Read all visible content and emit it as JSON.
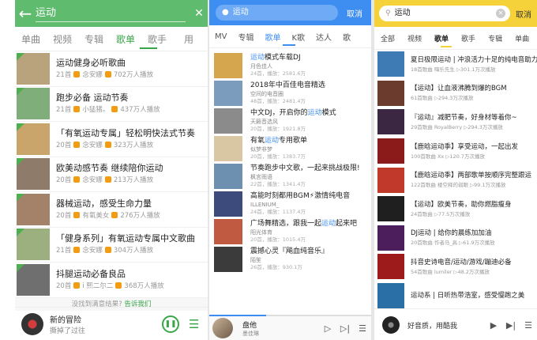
{
  "colors": {
    "panel1_accent": "#5fbb6d",
    "panel2_accent": "#3e8ef2",
    "panel3_accent": "#f6d23a"
  },
  "panel1": {
    "query": "运动",
    "icons": {
      "back": "back-arrow-icon",
      "clear": "close-icon",
      "pause": "pause-icon",
      "playlist": "playlist-icon"
    },
    "tabs": [
      "单曲",
      "视频",
      "专辑",
      "歌单",
      "歌手",
      "用"
    ],
    "active_tab": "歌单",
    "items": [
      {
        "title": "运动健身必听歌曲",
        "count": "21首",
        "author": "念安娜",
        "plays": "702万人播放",
        "thumb": "#b9a37d"
      },
      {
        "title": "跑步必备 运动节奏",
        "count": "21首",
        "author": "小猛猪。",
        "plays": "437万人播放",
        "thumb": "#7fae7a"
      },
      {
        "title": "「有氧运动专属」轻松明快法式节奏",
        "count": "20首",
        "author": "念安娜",
        "plays": "323万人播放",
        "thumb": "#c9a46b"
      },
      {
        "title": "欧美动感节奏 继续陪你运动",
        "count": "20首",
        "author": "念安娜",
        "plays": "213万人播放",
        "thumb": "#8f7b6a"
      },
      {
        "title": "器械运动，感受生命力量",
        "count": "20首",
        "author": "有氧美女",
        "plays": "276万人播放",
        "thumb": "#a4826a"
      },
      {
        "title": "「健身系列」有氧运动专属中文歌曲",
        "count": "21首",
        "author": "念安娜",
        "plays": "304万人播放",
        "thumb": "#9bb07e"
      },
      {
        "title": "抖腿运动必备良品",
        "count": "20首",
        "author": "i 熙二尔二",
        "plays": "368万人播放",
        "thumb": "#6f6f6f"
      }
    ],
    "not_found_text": "没找到满意结果?",
    "not_found_link": "告诉我们",
    "player": {
      "title": "新的冒险",
      "artist": "撕掉了过往"
    }
  },
  "panel2": {
    "query": "运动",
    "cancel": "取消",
    "icons": {
      "mic": "mic-icon",
      "play": "play-icon",
      "next": "next-icon",
      "list": "list-icon"
    },
    "tabs": [
      "MV",
      "专辑",
      "歌单",
      "K歌",
      "达人",
      "歌"
    ],
    "active_tab": "歌单",
    "items": [
      {
        "pre": "",
        "hl": "运动",
        "post": "模式车载DJ",
        "artist": "月色佳人",
        "meta": "24首，播放：2581.6万",
        "thumb": "#d6a64f"
      },
      {
        "pre": "2018年中百佳电音精选",
        "hl": "",
        "post": "",
        "artist": "空间的电音圈",
        "meta": "48首，播放：2481.4万",
        "thumb": "#7b9cbc"
      },
      {
        "pre": "中文DJ，开启你的",
        "hl": "运动",
        "post": "模式",
        "artist": "天籁音选风",
        "meta": "20首，播放：1921.8万",
        "thumb": "#8b8b8b"
      },
      {
        "pre": "有氧",
        "hl": "运动",
        "post": "专用歌单",
        "artist": "似梦非梦",
        "meta": "20首，播放：1383.7万",
        "thumb": "#d9c7a3"
      },
      {
        "pre": "节奏跑步中文歌，一起来挑战极限!",
        "hl": "",
        "post": "",
        "artist": "枫言雨语",
        "meta": "22首，播放：1341.4万",
        "thumb": "#6d8fb0"
      },
      {
        "pre": "高能时刻都用BGM⚡激情纯电音",
        "hl": "",
        "post": "",
        "artist": "ILLENIUM_",
        "meta": "24首，播放：1137.4万",
        "thumb": "#3d4a7c"
      },
      {
        "pre": "广场舞精选，跟我一起",
        "hl": "运动",
        "post": "起来吧",
        "artist": "阳光体育",
        "meta": "20首，播放：1015.4万",
        "thumb": "#c05a40"
      },
      {
        "pre": "震撼心灵『飚血纯音乐』",
        "hl": "",
        "post": "",
        "artist": "陌笙",
        "meta": "26首，播放：930.1万",
        "thumb": "#3b3b3b"
      }
    ],
    "progress": 0.35,
    "player": {
      "title": "盘他",
      "artist": "墨佳琳"
    }
  },
  "panel3": {
    "query": "运动",
    "cancel": "取消",
    "icons": {
      "search": "search-icon",
      "clear": "close-icon",
      "play": "play-icon",
      "next": "next-icon",
      "list": "list-icon"
    },
    "tabs": [
      "全部",
      "视频",
      "歌单",
      "歌手",
      "专辑",
      "单曲"
    ],
    "active_tab": "歌单",
    "items": [
      {
        "title": "夏日极限运动 | 冲浪活力十足的纯电音助力",
        "meta": "18首歌曲  嗨乐先生  ▷301.1万次播放",
        "thumb": "#3e7bb5"
      },
      {
        "title": "【运动】让血液沸腾到爆的BGM",
        "meta": "61首歌曲  ▷294.3万次播放",
        "thumb": "#6b3b2d"
      },
      {
        "title": "『运动』减肥节奏，好身材等着你~",
        "meta": "29首歌曲  RoyalBerry  ▷294.3万次播放",
        "thumb": "#3b2742"
      },
      {
        "title": "【鹿晗运动季】享受运动，一起出发",
        "meta": "100首歌曲  Xx  ▷120.7万次播放",
        "thumb": "#8b1a1a"
      },
      {
        "title": "【鹿晗运动季】两部歌单按顺序完整跟运",
        "meta": "122首歌曲  楼空释的弱眼  ▷99.1万次播放",
        "thumb": "#c0392b"
      },
      {
        "title": "【运动】欧美节奏，助你燃脂瘦身",
        "meta": "24首歌曲  ▷77.5万次播放",
        "thumb": "#1f1f1f"
      },
      {
        "title": "DJ运动 | 给你的晨练加加油",
        "meta": "20首歌曲  作者马_高  ▷61.9万次播放",
        "thumb": "#4c1f5c"
      },
      {
        "title": "抖音史诗电音/运动/游戏/蹦迪必备",
        "meta": "54首歌曲  lumiler  ▷48.2万次播放",
        "thumb": "#9e1b1b"
      },
      {
        "title": "运动系 | 日听热带浩室，感受慢跑之美",
        "meta": "",
        "thumb": "#2a6fa6"
      }
    ],
    "player": {
      "title": "好音质，用酷我"
    }
  }
}
